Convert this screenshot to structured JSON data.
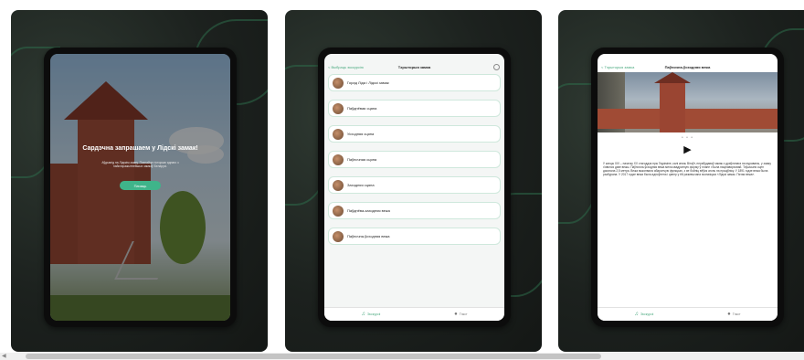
{
  "panel1": {
    "welcome_title": "Сардэчна запрашаем у Лідскі замак!",
    "welcome_sub": "Аўдыягід па Лідскім замку. Пазнайце гісторыю аднаго з найстаражытнейшых замкаў Беларусі.",
    "start_label": "Пачаць"
  },
  "panel2": {
    "back_label": "< Выбраць экскурсію",
    "title": "Тэрыторыя замка",
    "items": [
      {
        "label": "Горад Ліда і Лідскі замак"
      },
      {
        "label": "Паўднёвая сцяна"
      },
      {
        "label": "Усходняя сцяна"
      },
      {
        "label": "Паўночная сцяна"
      },
      {
        "label": "Заходняя сцяна"
      },
      {
        "label": "Паўднёва-заходняя вежа"
      },
      {
        "label": "Паўночна-ўсходняя вежа"
      }
    ],
    "tab_left": "Экскурсіі",
    "tab_right": "Тэкст"
  },
  "panel3": {
    "back_label": "< Тэрыторыя замка",
    "title": "Паўночна-ўсходняя вежа",
    "dots": "• • •",
    "play_icon": "▶",
    "description": "У канцы XIV – пачатку XV стагоддзя пры Гедзіміне, калі князь Вітаўт, перабудаваў замак з драўлянага на мураваны, у замку з'явіліся дзве вежы. Паўночна-ўсходняя вежа мела квадратную форму ў плане і была пяціпавярховай. Тоўшчыня сцен дасягала 2,5 метра. Вежа выконвала абарончую функцыю, з яе бойніц вёўся агонь па праціўніку. У 1891 годзе вежа была разбурана. У 2017 годзе вежа была адноўлена і цяпер у ёй размешчана экспазіцыя «Лідскі замак. Пятая вежа».",
    "tab_left": "Экскурсіі",
    "tab_right": "Тэкст"
  },
  "icons": {
    "play": "play-icon",
    "headphones": "headphones-icon",
    "text": "text-icon"
  },
  "colors": {
    "accent": "#4aa97f",
    "panel_bg": "#1c211e"
  }
}
